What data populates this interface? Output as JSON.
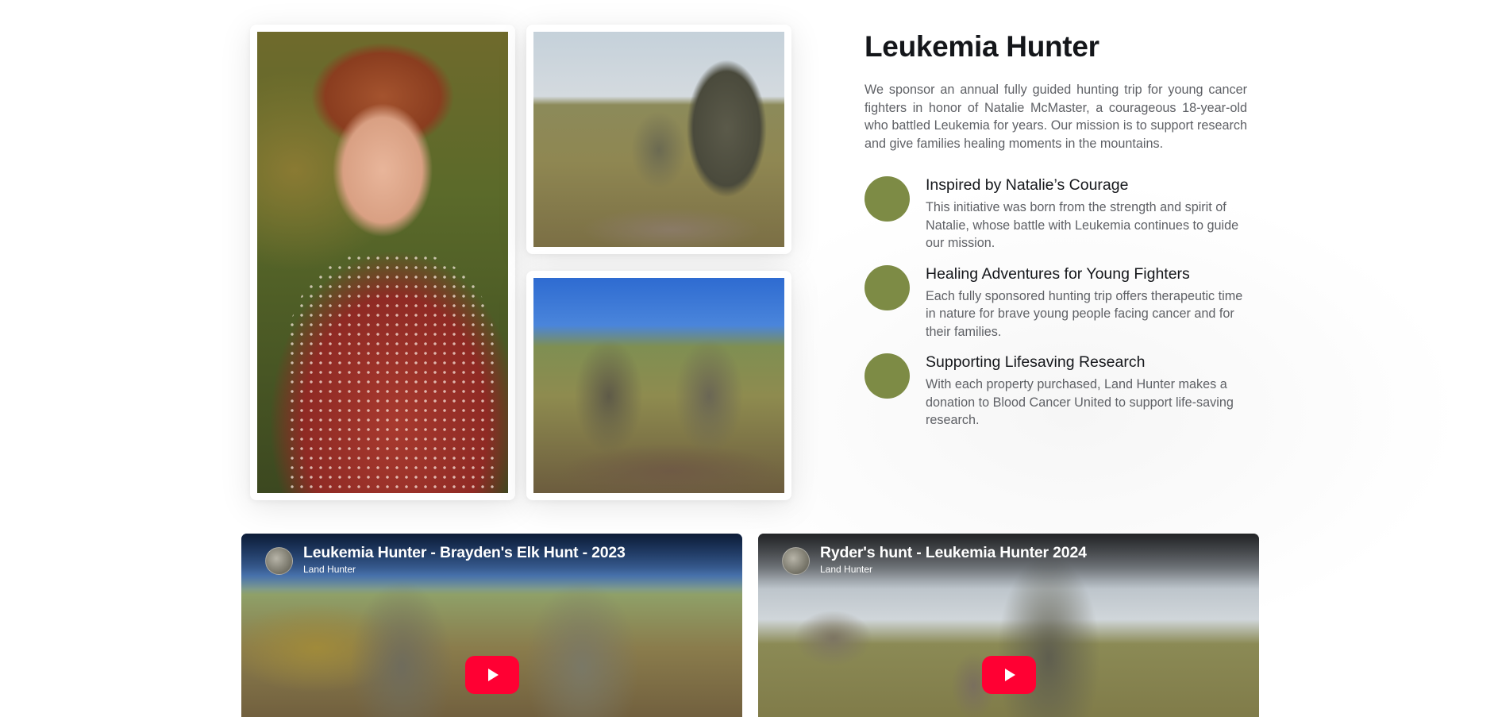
{
  "section": {
    "title": "Leukemia Hunter",
    "intro": "We sponsor an annual fully guided hunting trip for young cancer fighters in honor of Natalie McMaster, a courageous 18-year-old who battled Leukemia for years. Our mission is to support research and give families healing moments in the mountains.",
    "accent_color": "#7d8b45",
    "features": [
      {
        "title": "Inspired by Natalie’s Courage",
        "text": "This initiative was born from the strength and spirit of Natalie, whose battle with Leukemia continues to guide our mission."
      },
      {
        "title": "Healing Adventures for Young Fighters",
        "text": "Each fully sponsored hunting trip offers therapeutic time in nature for brave young people facing cancer and for their families."
      },
      {
        "title": "Supporting Lifesaving Research",
        "text": "With each property purchased, Land Hunter makes a donation to Blood Cancer United to support life-saving research."
      }
    ]
  },
  "videos": [
    {
      "title": "Leukemia Hunter - Brayden's Elk Hunt - 2023",
      "channel": "Land Hunter",
      "play_icon": "youtube-play-icon",
      "play_color": "#ff0033"
    },
    {
      "title": "Ryder's hunt - Leukemia Hunter 2024",
      "channel": "Land Hunter",
      "play_icon": "youtube-play-icon",
      "play_color": "#ff0033"
    }
  ]
}
